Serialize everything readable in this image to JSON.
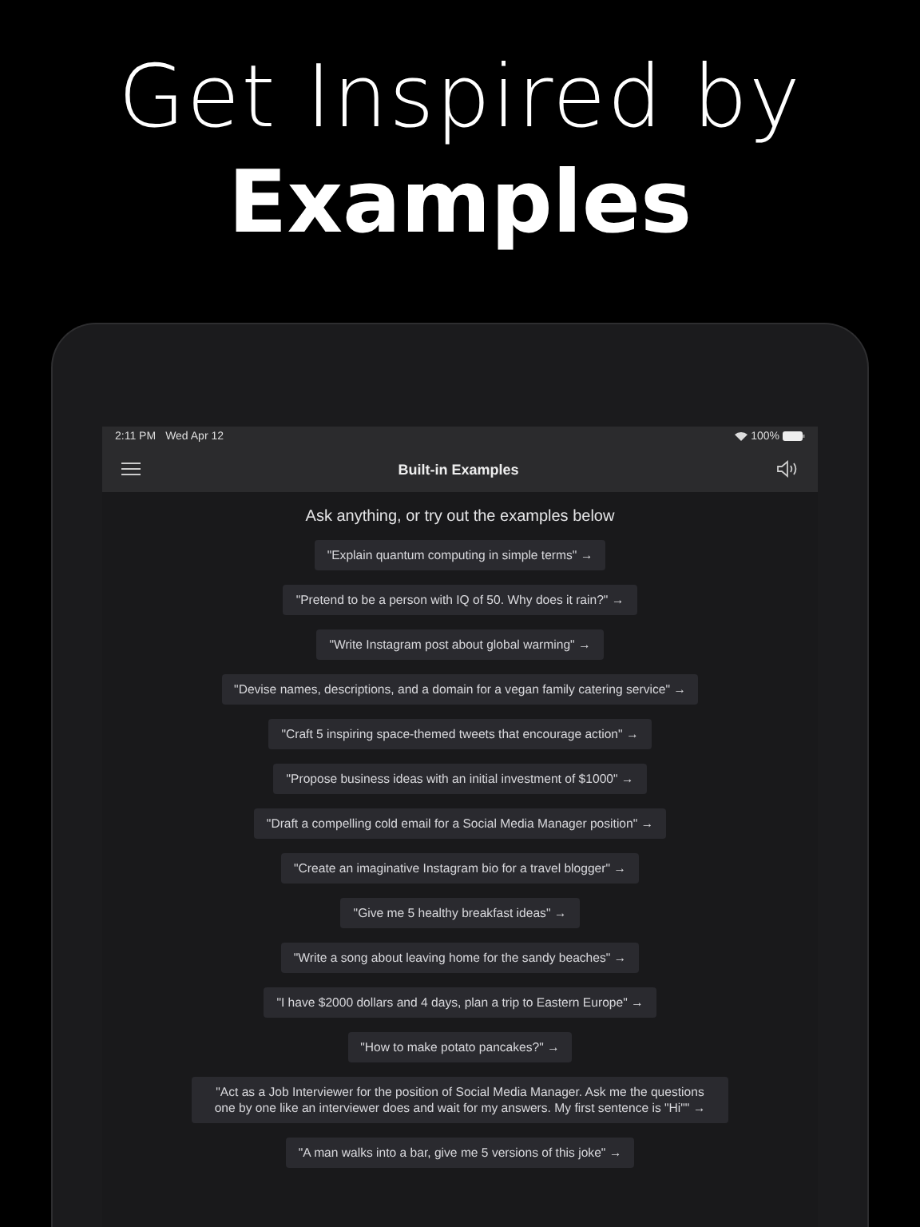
{
  "headline": {
    "line_1": "Get Inspired by",
    "line_2": "Examples"
  },
  "status_bar": {
    "time": "2:11 PM",
    "date": "Wed Apr 12",
    "battery": "100%"
  },
  "nav_bar": {
    "title": "Built-in Examples"
  },
  "intro": "Ask anything, or try out the examples below",
  "examples": [
    "\"Explain quantum computing in simple terms\" →",
    "\"Pretend to be a person with IQ of 50. Why does it rain?\" →",
    "\"Write Instagram post about global warming\" →",
    "\"Devise names, descriptions, and a domain for a vegan family catering service\" →",
    "\"Craft 5 inspiring space-themed tweets that encourage action\" →",
    "\"Propose business ideas with an initial investment of $1000\" →",
    "\"Draft a compelling cold email for a Social Media Manager position\" →",
    "\"Create an imaginative Instagram bio for a travel blogger\" →",
    "\"Give me 5 healthy breakfast ideas\" →",
    "\"Write a song about leaving home for the sandy beaches\" →",
    "\"I have $2000 dollars and 4 days, plan a trip to Eastern Europe\" →",
    "\"How to make potato pancakes?\" →",
    "\"Act as a Job Interviewer for the position of Social Media Manager. Ask me the questions one by one like an interviewer does and wait for my answers. My first sentence is \"Hi\"\" →",
    "\"A man walks into a bar, give me 5 versions of this joke\" →"
  ]
}
